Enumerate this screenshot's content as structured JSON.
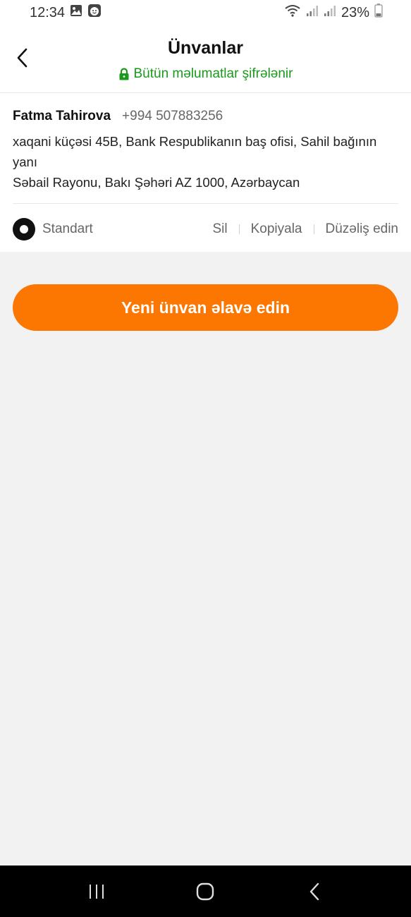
{
  "status_bar": {
    "time": "12:34",
    "battery": "23%",
    "left_icons": [
      "gallery-icon",
      "face-app-icon"
    ],
    "right_icons": [
      "wifi-icon",
      "signal-icon",
      "signal-icon",
      "battery-icon"
    ]
  },
  "header": {
    "title": "Ünvanlar",
    "subtitle": "Bütün məlumatlar şifrələnir",
    "back_icon": "chevron-left-icon",
    "lock_icon": "lock-icon"
  },
  "address_card": {
    "name": "Fatma Tahirova",
    "phone": "+994 507883256",
    "address_line_1": "xaqani küçəsi 45B, Bank Respublikanın baş ofisi, Sahil bağının yanı",
    "address_line_2": "Səbail Rayonu, Bakı Şəhəri AZ 1000, Azərbaycan",
    "default_label": "Standart",
    "is_default": true,
    "actions": {
      "delete": "Sil",
      "copy": "Kopiyala",
      "edit": "Düzəliş edin"
    }
  },
  "add_button": {
    "label": "Yeni ünvan əlavə edin"
  },
  "colors": {
    "accent": "#fb7701",
    "secure_green": "#1a9a1a",
    "background": "#f2f2f2"
  }
}
